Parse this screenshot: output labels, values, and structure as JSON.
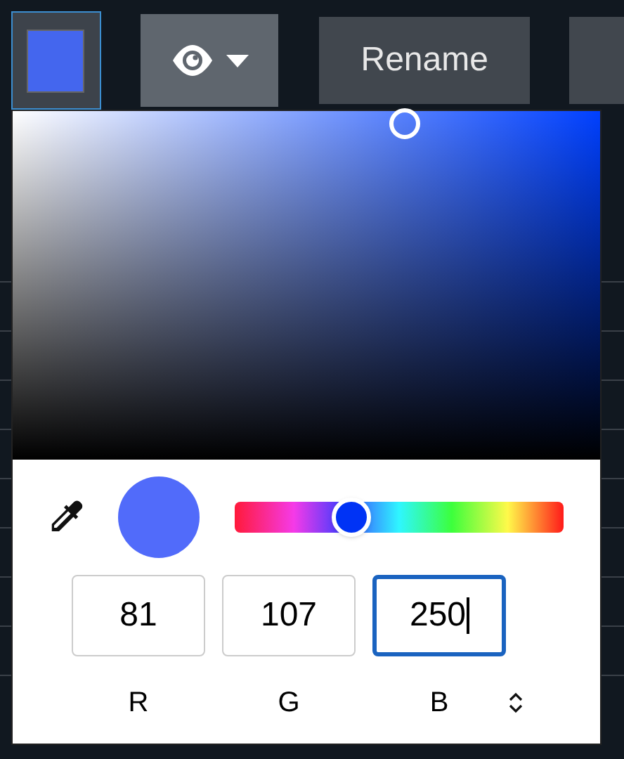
{
  "toolbar": {
    "buttons": [
      {
        "kind": "swatch"
      },
      {
        "kind": "visibility"
      },
      {
        "kind": "text",
        "label": "Rename"
      },
      {
        "kind": "cut"
      }
    ]
  },
  "picker": {
    "hue": {
      "level": 0.355
    },
    "channels": [
      {
        "label": "R",
        "value": "81",
        "focused": false
      },
      {
        "label": "G",
        "value": "107",
        "focused": false
      },
      {
        "label": "B",
        "value": "250",
        "focused": true
      }
    ]
  }
}
